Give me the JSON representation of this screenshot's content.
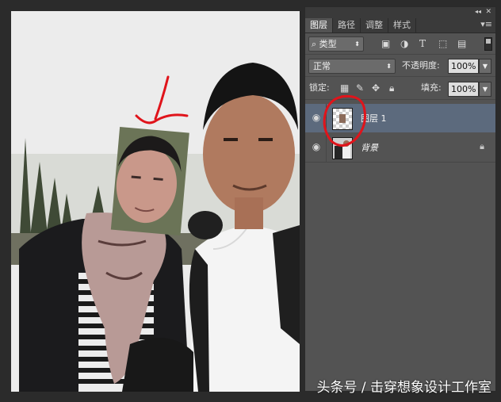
{
  "panel": {
    "tabs": [
      {
        "label": "图层",
        "active": true
      },
      {
        "label": "路径",
        "active": false
      },
      {
        "label": "调整",
        "active": false
      },
      {
        "label": "样式",
        "active": false
      }
    ],
    "filter": {
      "label": "类型",
      "icons": [
        "image-filter-icon",
        "adjustment-filter-icon",
        "text-filter-icon",
        "shape-filter-icon",
        "smart-object-filter-icon"
      ]
    },
    "blend_mode": "正常",
    "opacity_label": "不透明度:",
    "opacity_value": "100%",
    "lock_label": "锁定:",
    "fill_label": "填充:",
    "fill_value": "100%",
    "layers": [
      {
        "name": "图层 1",
        "selected": true,
        "visible": true
      },
      {
        "name": "背景",
        "selected": false,
        "visible": true,
        "locked": true
      }
    ]
  },
  "watermark": "头条号 / 击穿想象设计工作室",
  "colors": {
    "panel_bg": "#535353",
    "selected_layer": "#5c6a7d",
    "annotation_red": "#e0141b"
  }
}
